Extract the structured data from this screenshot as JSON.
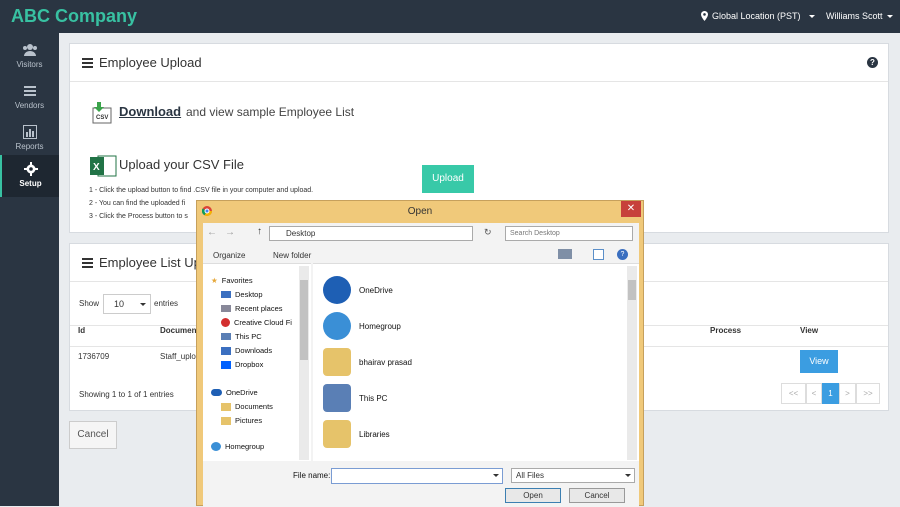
{
  "header": {
    "brand": "ABC Company",
    "location": "Global Location (PST)",
    "user": "Williams Scott"
  },
  "sidebar": {
    "items": [
      {
        "label": "Visitors",
        "icon": "users-icon"
      },
      {
        "label": "Vendors",
        "icon": "list-icon"
      },
      {
        "label": "Reports",
        "icon": "bar-chart-icon"
      },
      {
        "label": "Setup",
        "icon": "gear-icon",
        "active": true
      }
    ]
  },
  "upload_panel": {
    "title": "Employee Upload",
    "download_link": "Download",
    "download_text": "and view sample Employee List",
    "upload_heading": "Upload your CSV File",
    "upload_button": "Upload",
    "steps": [
      "1 - Click the upload button to find .CSV file in your computer and upload.",
      "2 - You can find the uploaded fi",
      "3 - Click the Process button to s"
    ]
  },
  "list_panel": {
    "title": "Employee List Uplo",
    "show_label": "Show",
    "page_size": "10",
    "entries_label": "entries",
    "columns": [
      "Id",
      "Documen",
      "Process",
      "View"
    ],
    "rows": [
      {
        "id": "1736709",
        "document": "Staff_uplo",
        "view": "View"
      }
    ],
    "showing": "Showing 1 to 1 of 1 entries",
    "pager": [
      "<<",
      "<",
      "1",
      ">",
      ">>"
    ]
  },
  "cancel_button": "Cancel",
  "dialog": {
    "title": "Open",
    "address": "Desktop",
    "search_placeholder": "Search Desktop",
    "organize": "Organize",
    "new_folder": "New folder",
    "tree": [
      {
        "label": "Favorites",
        "icon": "star-icon"
      },
      {
        "label": "Desktop",
        "icon": "desktop-icon"
      },
      {
        "label": "Recent places",
        "icon": "recent-icon"
      },
      {
        "label": "Creative Cloud Fi",
        "icon": "creative-cloud-icon"
      },
      {
        "label": "This PC",
        "icon": "computer-icon"
      },
      {
        "label": "Downloads",
        "icon": "downloads-icon"
      },
      {
        "label": "Dropbox",
        "icon": "dropbox-icon"
      },
      {
        "label": "OneDrive",
        "icon": "onedrive-icon"
      },
      {
        "label": "Documents",
        "icon": "folder-icon"
      },
      {
        "label": "Pictures",
        "icon": "folder-icon"
      },
      {
        "label": "Homegroup",
        "icon": "homegroup-icon"
      }
    ],
    "files": [
      "OneDrive",
      "Homegroup",
      "bhairav prasad",
      "This PC",
      "Libraries"
    ],
    "file_name_label": "File name:",
    "file_filter": "All Files",
    "open_button": "Open",
    "cancel_button": "Cancel"
  }
}
